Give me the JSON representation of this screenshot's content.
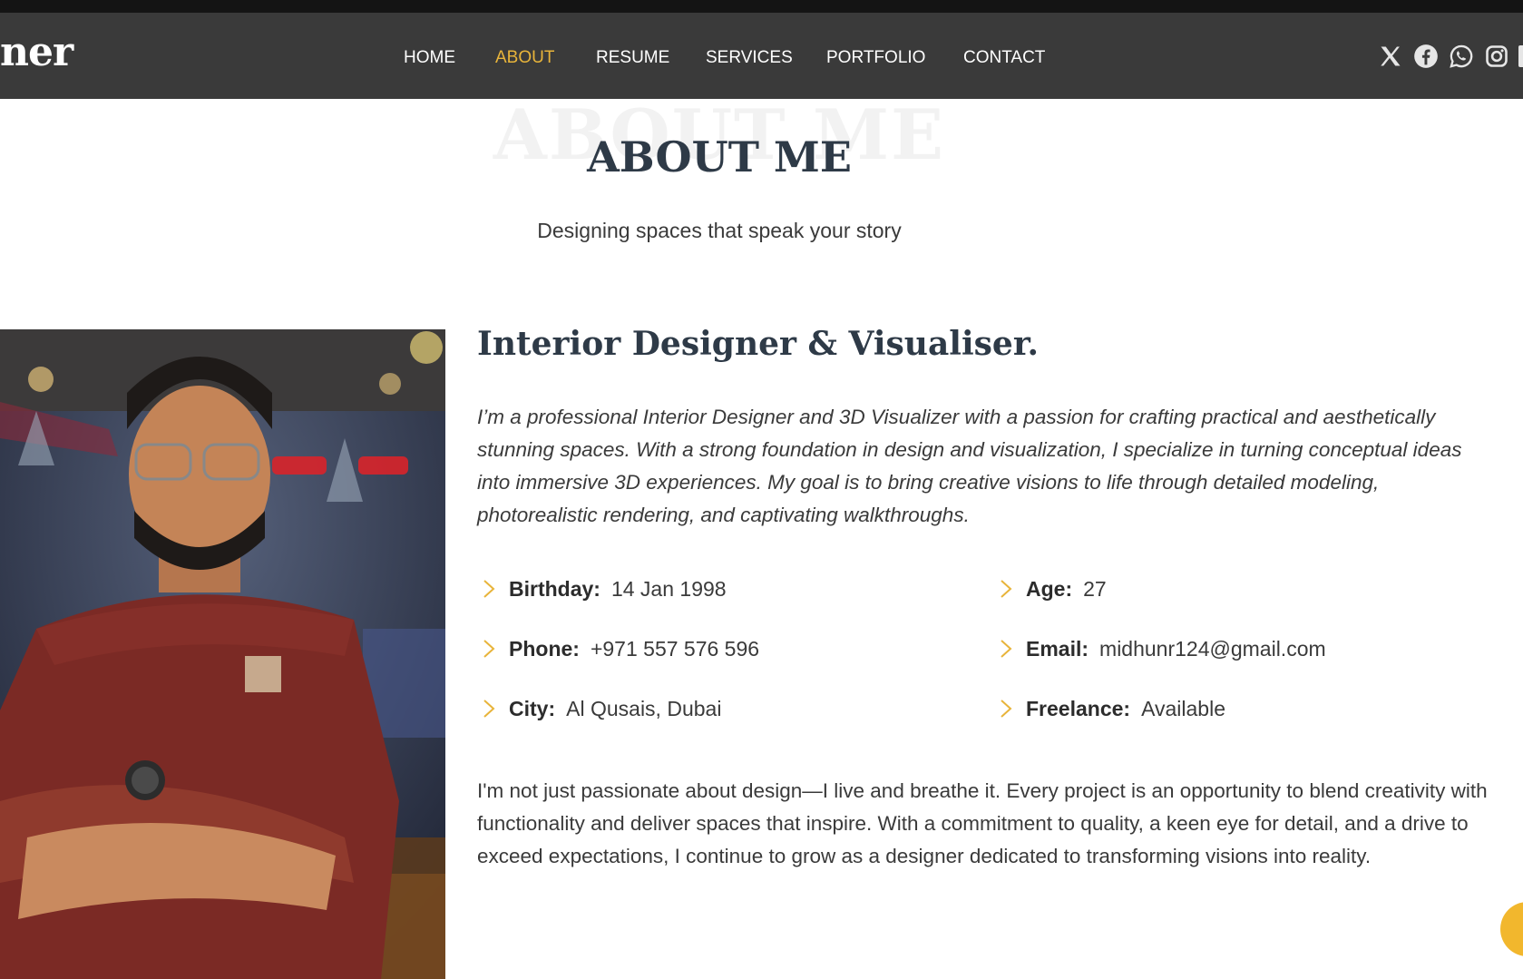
{
  "header": {
    "logo_text": "ner",
    "nav": [
      {
        "label": "HOME",
        "active": false
      },
      {
        "label": "ABOUT",
        "active": true
      },
      {
        "label": "RESUME",
        "active": false
      },
      {
        "label": "SERVICES",
        "active": false
      },
      {
        "label": "PORTFOLIO",
        "active": false
      },
      {
        "label": "CONTACT",
        "active": false
      }
    ],
    "social_icons": [
      "x-icon",
      "facebook-icon",
      "whatsapp-icon",
      "instagram-icon"
    ]
  },
  "section": {
    "bg_title": "ABOUT ME",
    "title": "ABOUT ME",
    "subtitle": "Designing spaces that speak your story"
  },
  "about": {
    "role": "Interior Designer & Visualiser.",
    "intro": "I’m a professional Interior Designer and 3D Visualizer with a passion for crafting practical and aesthetically stunning spaces. With a strong foundation in design and visualization, I specialize in turning conceptual ideas into immersive 3D experiences. My goal is to bring creative visions to life through detailed modeling, photorealistic rendering, and captivating walkthroughs.",
    "info": [
      {
        "key": "Birthday:",
        "value": "14 Jan 1998"
      },
      {
        "key": "Age:",
        "value": "27"
      },
      {
        "key": "Phone:",
        "value": "+971 557 576 596"
      },
      {
        "key": "Email:",
        "value": "midhunr124@gmail.com"
      },
      {
        "key": "City:",
        "value": "Al Qusais, Dubai"
      },
      {
        "key": "Freelance:",
        "value": "Available"
      }
    ],
    "outro": "I'm not just passionate about design—I live and breathe it. Every project is an opportunity to blend creativity with functionality and deliver spaces that inspire. With a commitment to quality, a keen eye for detail, and a drive to exceed expectations, I continue to grow as a designer dedicated to transforming visions into reality."
  },
  "colors": {
    "accent": "#e8b43a",
    "header_bg": "#3a3a3a",
    "heading": "#2e3a47",
    "fab": "#f2b72d"
  }
}
